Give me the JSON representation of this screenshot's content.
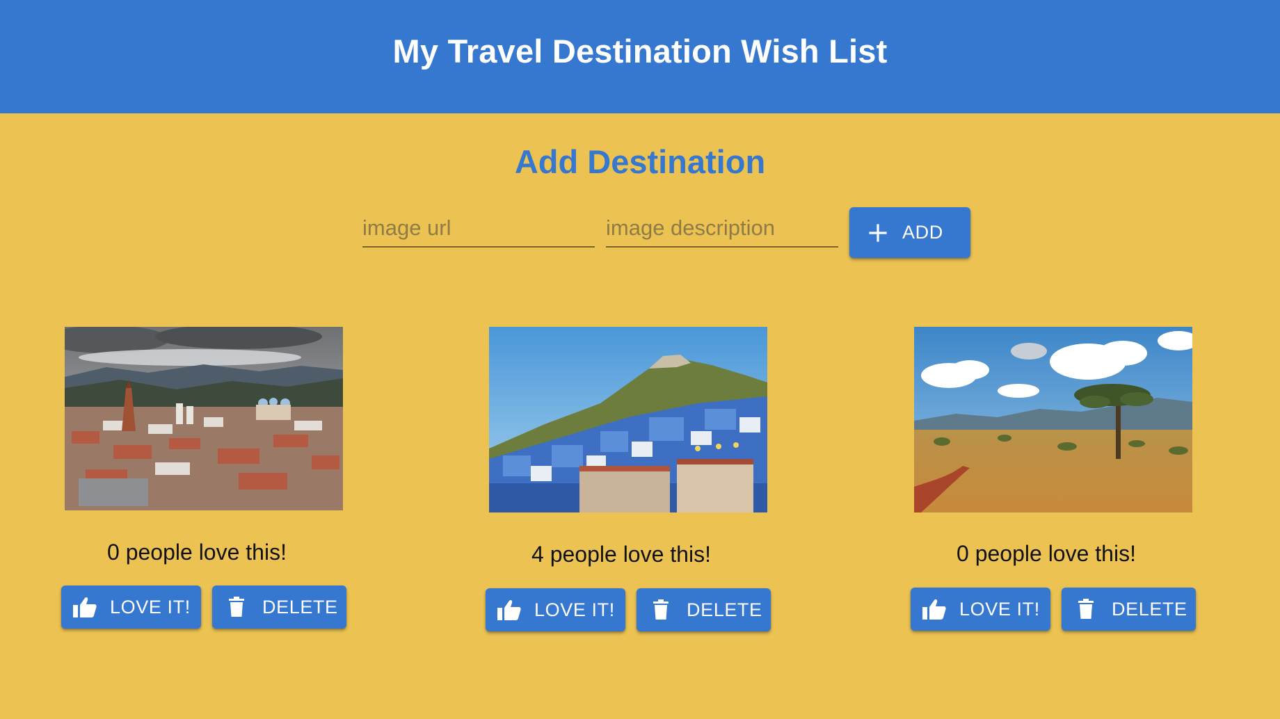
{
  "header": {
    "title": "My Travel Destination Wish List"
  },
  "add_form": {
    "title": "Add Destination",
    "url_placeholder": "image url",
    "description_placeholder": "image description",
    "add_label": "ADD"
  },
  "destinations": [
    {
      "love_text": "0 people love this!",
      "love_count": 0,
      "love_label": "LOVE IT!",
      "delete_label": "DELETE",
      "scene": "city-with-cathedral-domes"
    },
    {
      "love_text": "4 people love this!",
      "love_count": 4,
      "love_label": "LOVE IT!",
      "delete_label": "DELETE",
      "scene": "blue-hillside-town"
    },
    {
      "love_text": "0 people love this!",
      "love_count": 0,
      "love_label": "LOVE IT!",
      "delete_label": "DELETE",
      "scene": "savanna-acacia-tree"
    }
  ],
  "colors": {
    "primary": "#3677cf",
    "background": "#ecc353",
    "button_text": "#ffffff"
  }
}
